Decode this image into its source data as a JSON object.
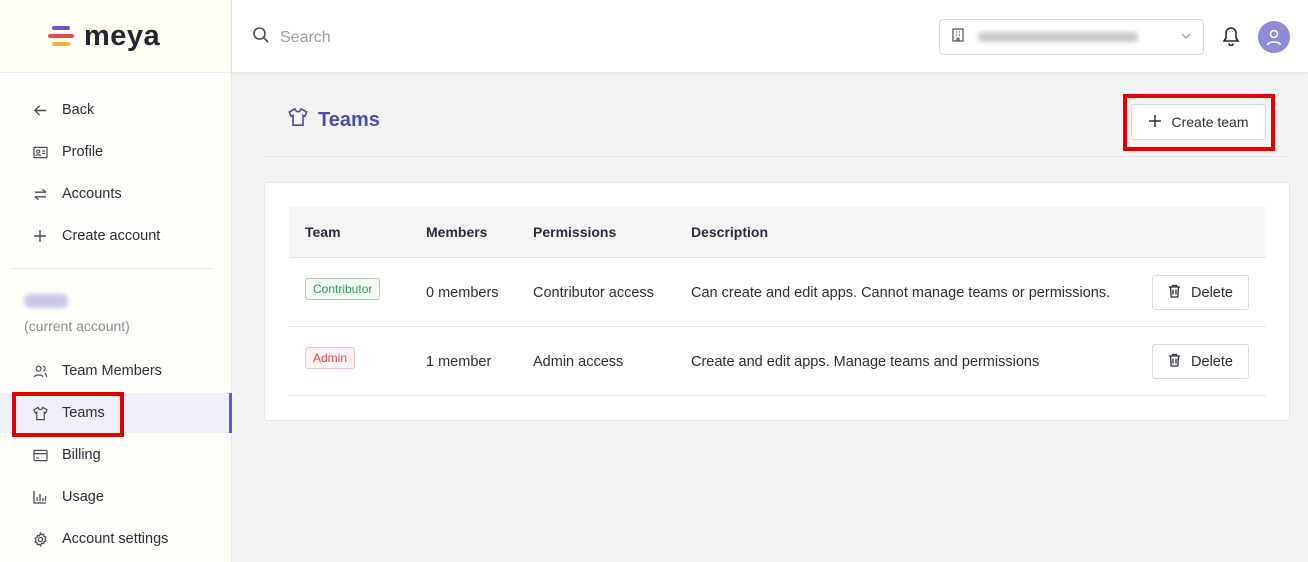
{
  "brand": {
    "name": "meya",
    "logo_colors": [
      "#5b5bd6",
      "#e24b5b",
      "#f2b233"
    ]
  },
  "sidebar": {
    "top_items": [
      {
        "label": "Back",
        "icon": "arrow-left-icon"
      },
      {
        "label": "Profile",
        "icon": "id-card-icon"
      },
      {
        "label": "Accounts",
        "icon": "swap-icon"
      },
      {
        "label": "Create account",
        "icon": "plus-icon"
      }
    ],
    "current_account_label": "(current account)",
    "account_items": [
      {
        "label": "Team Members",
        "icon": "users-icon"
      },
      {
        "label": "Teams",
        "icon": "shirt-icon",
        "active": true
      },
      {
        "label": "Billing",
        "icon": "credit-card-icon"
      },
      {
        "label": "Usage",
        "icon": "bar-chart-icon"
      },
      {
        "label": "Account settings",
        "icon": "gear-icon"
      }
    ]
  },
  "topbar": {
    "search_placeholder": "Search"
  },
  "main": {
    "title": "Teams",
    "create_button": "Create team",
    "columns": [
      "Team",
      "Members",
      "Permissions",
      "Description"
    ],
    "rows": [
      {
        "team": "Contributor",
        "team_color": "green",
        "members": "0 members",
        "permissions": "Contributor access",
        "description": "Can create and edit apps. Cannot manage teams or permissions.",
        "action": "Delete"
      },
      {
        "team": "Admin",
        "team_color": "red",
        "members": "1 member",
        "permissions": "Admin access",
        "description": "Create and edit apps. Manage teams and permissions",
        "action": "Delete"
      }
    ]
  },
  "colors": {
    "accent": "#5b5bd6",
    "highlight": "#e00000"
  }
}
